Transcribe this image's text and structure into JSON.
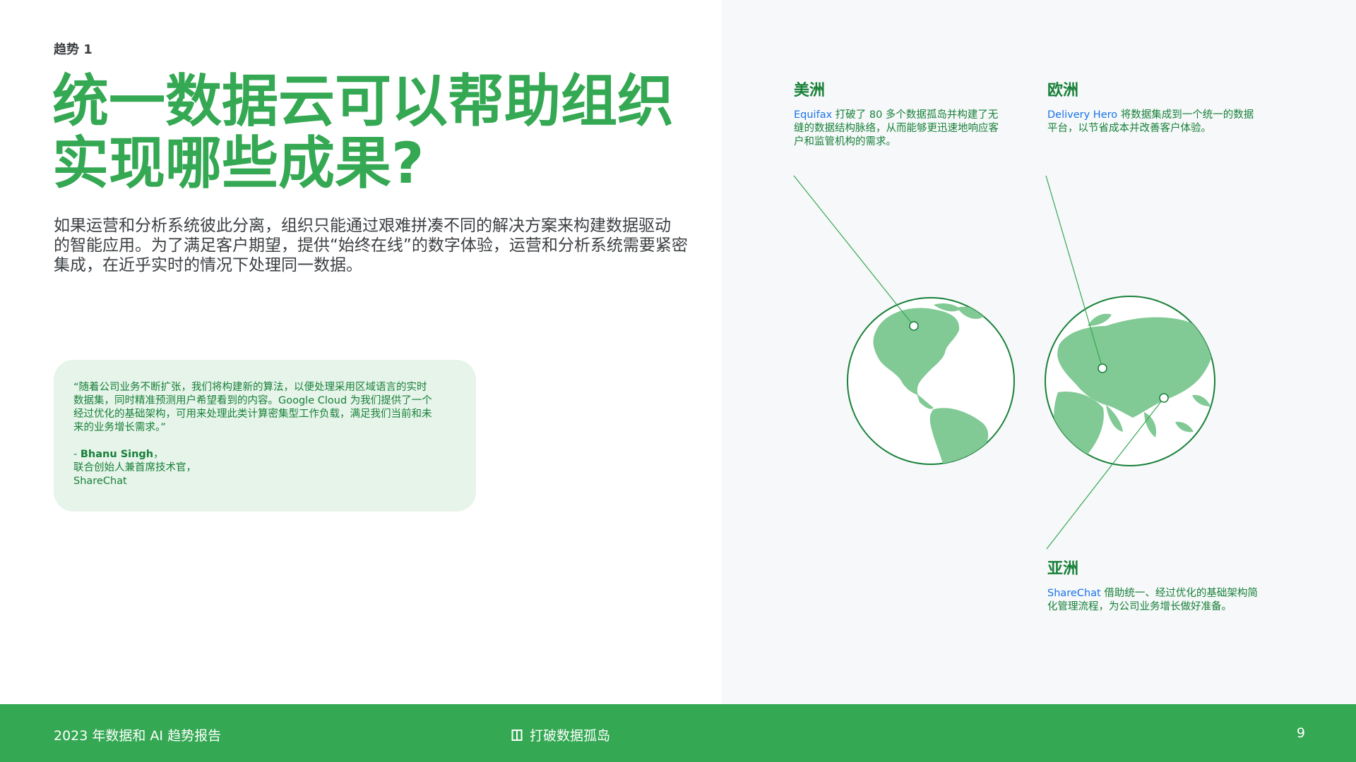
{
  "trend_label": "趋势 1",
  "headline": {
    "line1": "统一数据云可以帮助组织",
    "line2": "实现哪些成果?"
  },
  "intro": {
    "line1": "如果运营和分析系统彼此分离，组织只能通过艰难拼凑不同的解决方案来构建数据驱动",
    "line2": "的智能应用。为了满足客户期望，提供“始终在线”的数字体验，运营和分析系统需要紧密",
    "line3": "集成，在近乎实时的情况下处理同一数据。"
  },
  "quote": {
    "line1": "“随着公司业务不断扩张，我们将构建新的算法，以便处理采用区域语言的实时",
    "line2": "数据集，同时精准预测用户希望看到的内容。Google Cloud 为我们提供了一个",
    "line3": "经过优化的基础架构，可用来处理此类计算密集型工作负载，满足我们当前和未",
    "line4": "来的业务增长需求。”",
    "dash": "- ",
    "name": "Bhanu Singh",
    "name_suffix": "，",
    "role": "联合创始人兼首席技术官，",
    "company": "ShareChat"
  },
  "regions": {
    "americas": {
      "title": "美洲",
      "company": "Equifax",
      "line1": " 打破了 80 多个数据孤岛并构建了无",
      "line2": "缝的数据结构脉络，从而能够更迅速地响应客",
      "line3": "户和监管机构的需求。"
    },
    "europe": {
      "title": "欧洲",
      "company": "Delivery Hero",
      "line1": " 将数据集成到一个统一的数据",
      "line2": "平台，以节省成本并改善客户体验。"
    },
    "asia": {
      "title": "亚洲",
      "company": "ShareChat",
      "line1": " 借助统一、经过优化的基础架构简",
      "line2": "化管理流程，为公司业务增长做好准备。"
    }
  },
  "footer": {
    "report_title": "2023 年数据和 AI 趋势报告",
    "section_icon": "book-icon",
    "section_title": "打破数据孤岛",
    "page_number": "9"
  },
  "colors": {
    "brand_green": "#34a853",
    "dark_green": "#188038",
    "light_green": "#e6f4ea",
    "land_green": "#81c995",
    "company_blue": "#1a73e8",
    "panel_gray": "#f6f8fa"
  }
}
